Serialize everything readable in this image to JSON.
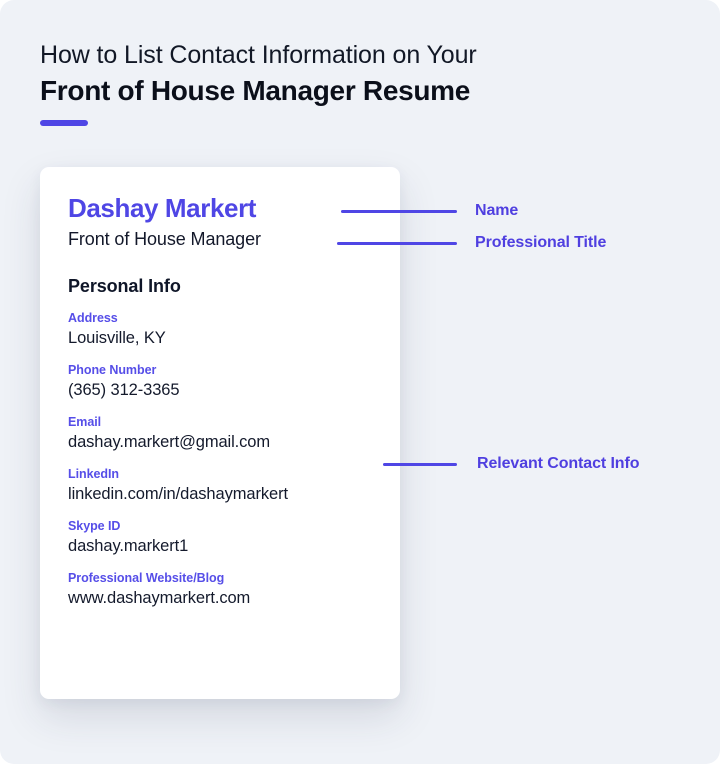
{
  "heading": {
    "line1": "How to List Contact Information on Your",
    "line2": "Front of House Manager Resume"
  },
  "colors": {
    "accent": "#4f46e5",
    "label_purple": "#564ee8",
    "annotation_purple": "#4f3fe0",
    "page_background": "#eff2f7",
    "card_background": "#ffffff",
    "text_dark": "#0f1628"
  },
  "resume_card": {
    "candidate_name": "Dashay Markert",
    "professional_title": "Front of House Manager",
    "section_heading": "Personal Info",
    "contacts": [
      {
        "label": "Address",
        "value": "Louisville, KY"
      },
      {
        "label": "Phone Number",
        "value": "(365) 312-3365"
      },
      {
        "label": "Email",
        "value": "dashay.markert@gmail.com"
      },
      {
        "label": "LinkedIn",
        "value": "linkedin.com/in/dashaymarkert"
      },
      {
        "label": "Skype ID",
        "value": "dashay.markert1"
      },
      {
        "label": "Professional Website/Blog",
        "value": "www.dashaymarkert.com"
      }
    ]
  },
  "annotations": [
    {
      "label": "Name"
    },
    {
      "label": "Professional Title"
    },
    {
      "label": "Relevant Contact Info"
    }
  ]
}
